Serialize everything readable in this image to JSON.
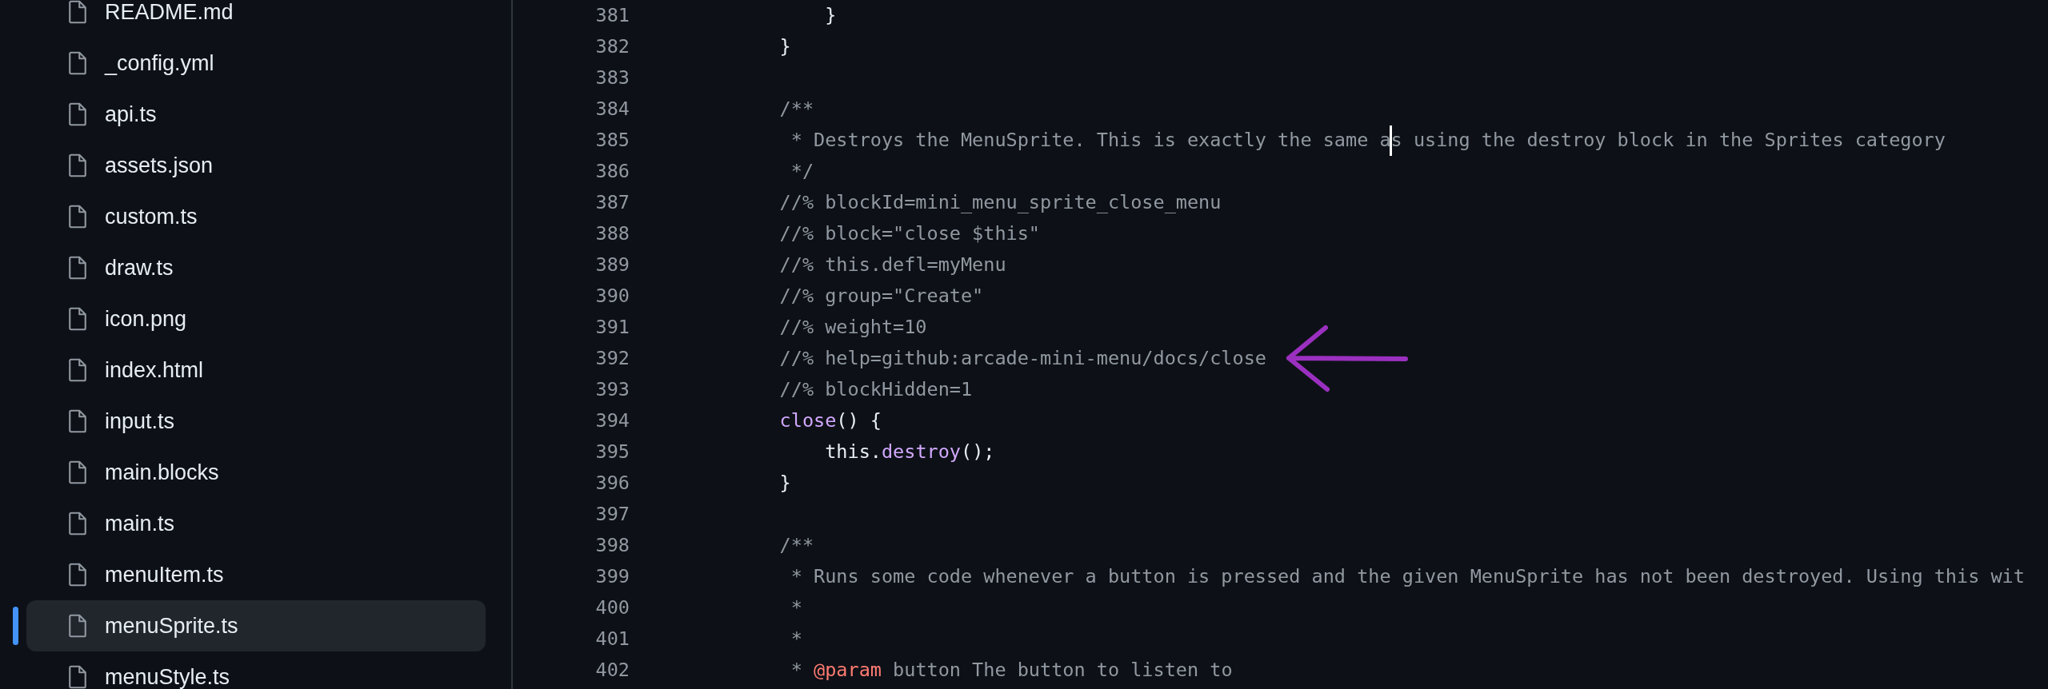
{
  "files": [
    {
      "name": "README.md",
      "selected": false
    },
    {
      "name": "_config.yml",
      "selected": false
    },
    {
      "name": "api.ts",
      "selected": false
    },
    {
      "name": "assets.json",
      "selected": false
    },
    {
      "name": "custom.ts",
      "selected": false
    },
    {
      "name": "draw.ts",
      "selected": false
    },
    {
      "name": "icon.png",
      "selected": false
    },
    {
      "name": "index.html",
      "selected": false
    },
    {
      "name": "input.ts",
      "selected": false
    },
    {
      "name": "main.blocks",
      "selected": false
    },
    {
      "name": "main.ts",
      "selected": false
    },
    {
      "name": "menuItem.ts",
      "selected": false
    },
    {
      "name": "menuSprite.ts",
      "selected": true
    },
    {
      "name": "menuStyle.ts",
      "selected": false
    }
  ],
  "code_lines": [
    {
      "number": "381",
      "segments": [
        {
          "kind": "plain",
          "text": "        }"
        }
      ]
    },
    {
      "number": "382",
      "segments": [
        {
          "kind": "plain",
          "text": "    }"
        }
      ]
    },
    {
      "number": "383"
    },
    {
      "number": "384",
      "segments": [
        {
          "kind": "comment",
          "text": "    /**"
        }
      ]
    },
    {
      "number": "385",
      "segments": [
        {
          "kind": "comment",
          "text": "     * Destroys the MenuSprite. This is exactly the same a"
        },
        {
          "kind": "cursor"
        },
        {
          "kind": "comment",
          "text": "s using the destroy block in the Sprites category"
        }
      ]
    },
    {
      "number": "386",
      "segments": [
        {
          "kind": "comment",
          "text": "     */"
        }
      ]
    },
    {
      "number": "387",
      "segments": [
        {
          "kind": "comment",
          "text": "    //% blockId=mini_menu_sprite_close_menu"
        }
      ]
    },
    {
      "number": "388",
      "segments": [
        {
          "kind": "comment",
          "text": "    //% block=\"close $this\""
        }
      ]
    },
    {
      "number": "389",
      "segments": [
        {
          "kind": "comment",
          "text": "    //% this.defl=myMenu"
        }
      ]
    },
    {
      "number": "390",
      "segments": [
        {
          "kind": "comment",
          "text": "    //% group=\"Create\""
        }
      ]
    },
    {
      "number": "391",
      "segments": [
        {
          "kind": "comment",
          "text": "    //% weight=10"
        }
      ]
    },
    {
      "number": "392",
      "segments": [
        {
          "kind": "comment",
          "text": "    //% help=github:arcade-mini-menu/docs/close"
        }
      ]
    },
    {
      "number": "393",
      "segments": [
        {
          "kind": "comment",
          "text": "    //% blockHidden=1"
        }
      ]
    },
    {
      "number": "394",
      "segments": [
        {
          "kind": "function",
          "text": "    close"
        },
        {
          "kind": "plain",
          "text": "() {"
        }
      ]
    },
    {
      "number": "395",
      "segments": [
        {
          "kind": "plain",
          "text": "        this."
        },
        {
          "kind": "function",
          "text": "destroy"
        },
        {
          "kind": "plain",
          "text": "();"
        }
      ]
    },
    {
      "number": "396",
      "segments": [
        {
          "kind": "plain",
          "text": "    }"
        }
      ]
    },
    {
      "number": "397"
    },
    {
      "number": "398",
      "segments": [
        {
          "kind": "comment",
          "text": "    /**"
        }
      ]
    },
    {
      "number": "399",
      "segments": [
        {
          "kind": "comment",
          "text": "     * Runs some code whenever a button is pressed and the given MenuSprite has not been destroyed. Using this wit"
        }
      ]
    },
    {
      "number": "400",
      "segments": [
        {
          "kind": "comment",
          "text": "     *"
        }
      ]
    },
    {
      "number": "401",
      "segments": [
        {
          "kind": "comment",
          "text": "     *"
        }
      ]
    },
    {
      "number": "402",
      "segments": [
        {
          "kind": "comment",
          "text": "     * "
        },
        {
          "kind": "tag",
          "text": "@param"
        },
        {
          "kind": "comment",
          "text": " button The button to listen to"
        }
      ]
    }
  ]
}
